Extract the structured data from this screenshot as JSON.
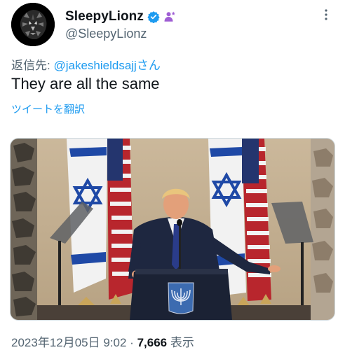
{
  "author": {
    "display_name": "SleepyLionz",
    "handle": "@SleepyLionz",
    "avatar_icon": "lion-head-icon",
    "verified_icon": "verified-badge-icon",
    "affiliate_icon": "affiliate-badge-icon"
  },
  "header": {
    "more_icon": "more-vertical-icon"
  },
  "reply": {
    "prefix": "返信先: ",
    "mention": "@jakeshieldsajj",
    "suffix": "さん"
  },
  "tweet": {
    "text": "They are all the same",
    "translate_label": "ツイートを翻訳"
  },
  "media": {
    "description_icon": "photo-icon"
  },
  "meta": {
    "timestamp": "2023年12月05日 9:02",
    "separator": " · ",
    "views_count": "7,666",
    "views_label": " 表示"
  },
  "colors": {
    "link": "#1d9bf0",
    "secondary_text": "#536471",
    "primary_text": "#0f1419",
    "verified": "#1d9bf0",
    "affiliate": "#a05fd4"
  }
}
